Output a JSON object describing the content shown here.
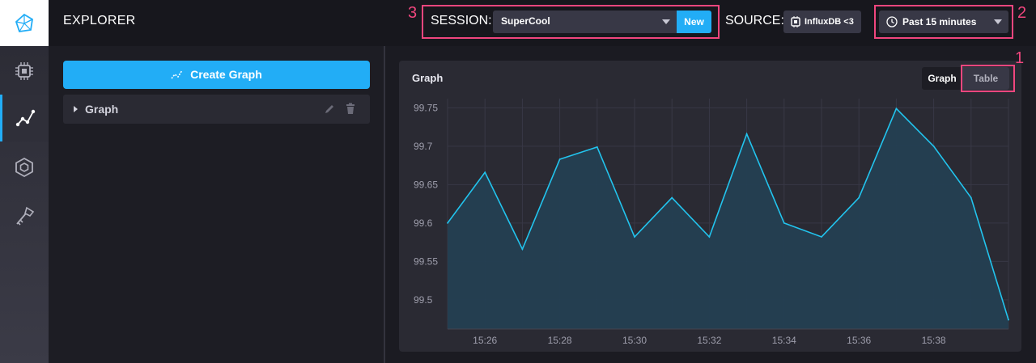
{
  "topbar": {
    "title": "EXPLORER",
    "session_label": "SESSION:",
    "session_value": "SuperCool",
    "new_label": "New",
    "source_label": "SOURCE:",
    "source_value": "InfluxDB <3",
    "time_range": "Past 15 minutes"
  },
  "annotations": {
    "one": "1",
    "two": "2",
    "three": "3"
  },
  "sidebar": {
    "items": [
      {
        "icon": "cpu-chip-icon"
      },
      {
        "icon": "graph-icon",
        "active": true
      },
      {
        "icon": "hexagon-icon"
      },
      {
        "icon": "key-icon"
      }
    ]
  },
  "left_panel": {
    "create_button": "Create Graph",
    "graph_item": "Graph"
  },
  "card": {
    "title": "Graph",
    "toggle_graph": "Graph",
    "toggle_table": "Table"
  },
  "colors": {
    "accent": "#22adf6",
    "highlight": "#f0467e",
    "line": "#22c4ee",
    "fill": "#243f52"
  },
  "chart_data": {
    "type": "area",
    "title": "",
    "xlabel": "",
    "ylabel": "",
    "x": [
      "15:25",
      "15:26",
      "15:27",
      "15:28",
      "15:29",
      "15:30",
      "15:31",
      "15:32",
      "15:33",
      "15:34",
      "15:35",
      "15:36",
      "15:37",
      "15:38",
      "15:39",
      "15:40"
    ],
    "series": [
      {
        "values": [
          99.6,
          99.666,
          99.566,
          99.683,
          99.699,
          99.582,
          99.633,
          99.582,
          99.716,
          99.6,
          99.582,
          99.633,
          99.749,
          99.7,
          99.633,
          99.474
        ]
      }
    ],
    "yticks": [
      "99.5",
      "99.55",
      "99.6",
      "99.65",
      "99.7",
      "99.75"
    ],
    "xticks": [
      "15:26",
      "15:28",
      "15:30",
      "15:32",
      "15:34",
      "15:36",
      "15:38"
    ],
    "ylim": [
      99.462,
      99.762
    ],
    "grid": true,
    "legend": "none"
  }
}
